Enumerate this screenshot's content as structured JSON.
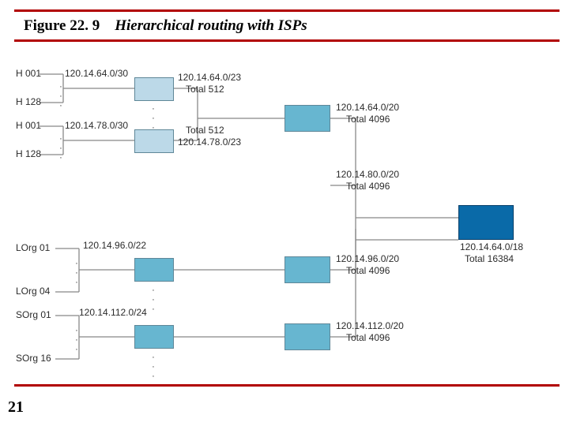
{
  "figure": {
    "number": "Figure 22. 9",
    "caption": "Hierarchical routing with ISPs"
  },
  "pageNumber": "21",
  "chart_data": {
    "type": "diagram",
    "title": "Hierarchical routing with ISPs",
    "hosts": {
      "top": {
        "first": "H 001",
        "last": "H 128",
        "cidr": "120.14.64.0/30"
      },
      "bottom": {
        "first": "H 001",
        "last": "H 128",
        "cidr": "120.14.78.0/30"
      }
    },
    "local_isp_top": {
      "cidr": "120.14.64.0/23",
      "total_label": "Total 512",
      "total": 512
    },
    "local_isp_bottom": {
      "cidr": "120.14.78.0/23",
      "total_label": "Total 512",
      "total": 512
    },
    "lorg": {
      "first": "LOrg 01",
      "last": "LOrg 04",
      "cidr": "120.14.96.0/22"
    },
    "sorg": {
      "first": "SOrg 01",
      "last": "SOrg 16",
      "cidr": "120.14.112.0/24"
    },
    "regional_1": {
      "cidr": "120.14.64.0/20",
      "total_label": "Total 4096",
      "total": 4096
    },
    "regional_2": {
      "cidr": "120.14.80.0/20",
      "total_label": "Total 4096",
      "total": 4096
    },
    "regional_3": {
      "cidr": "120.14.96.0/20",
      "total_label": "Total 4096",
      "total": 4096
    },
    "regional_4": {
      "cidr": "120.14.112.0/20",
      "total_label": "Total 4096",
      "total": 4096
    },
    "backbone": {
      "cidr": "120.14.64.0/18",
      "total_label": "Total 16384",
      "total": 16384
    }
  }
}
